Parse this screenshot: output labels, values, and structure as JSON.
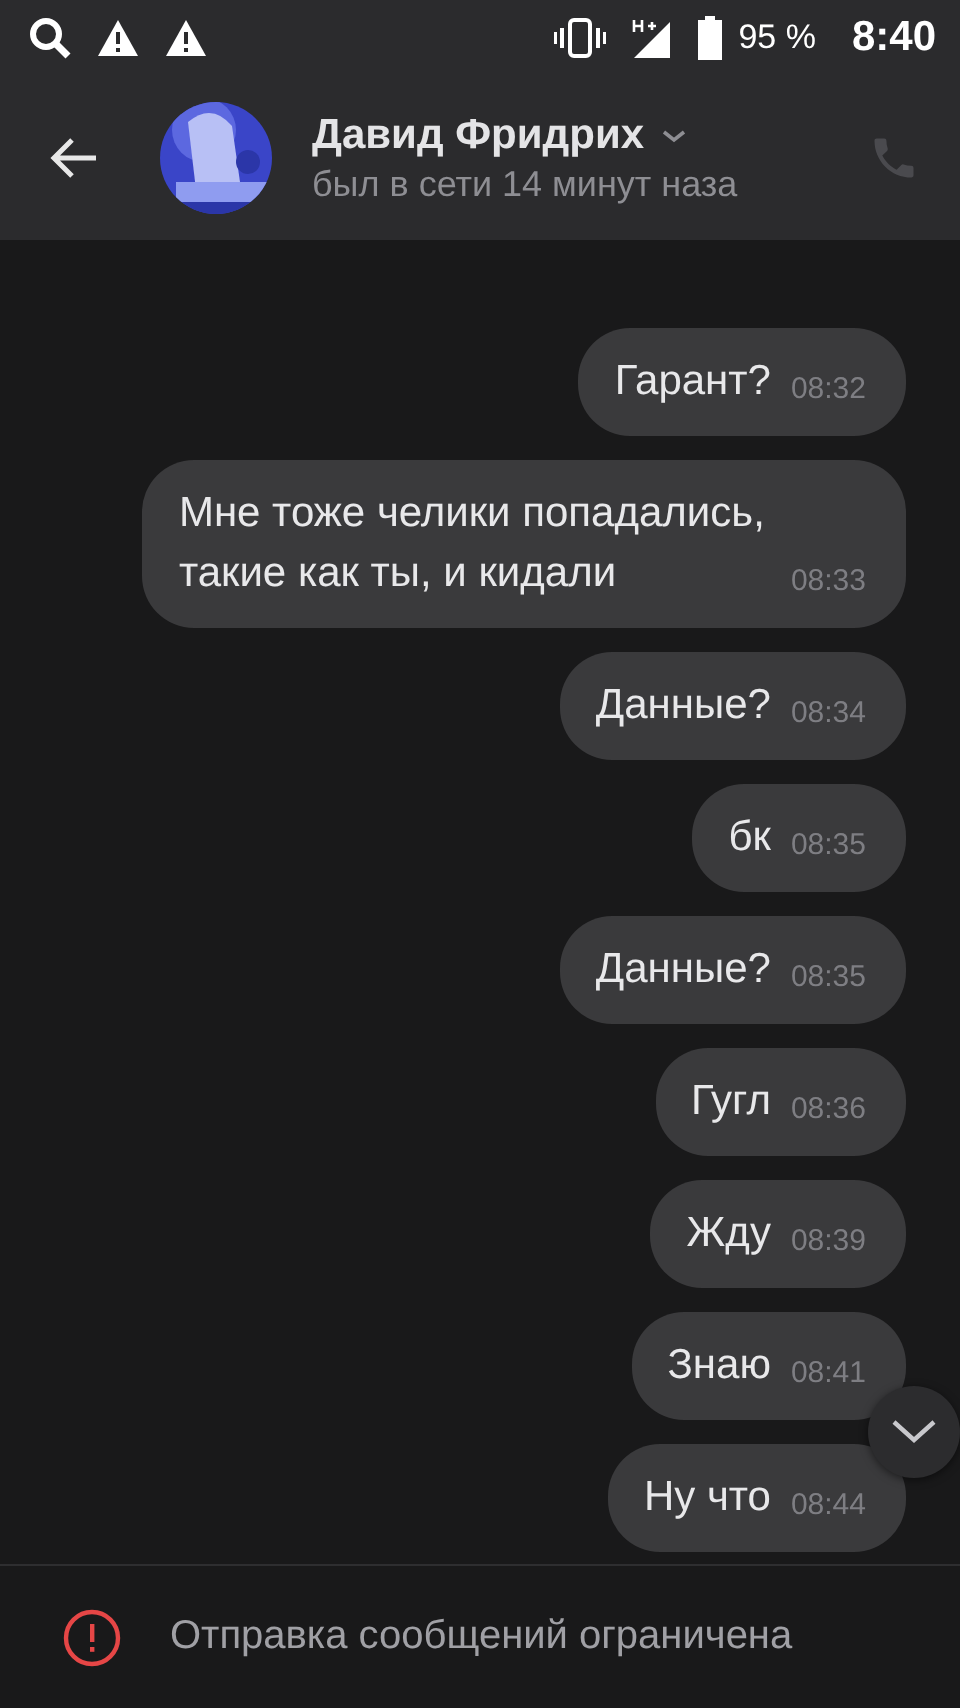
{
  "status_bar": {
    "battery": "95 %",
    "time": "8:40"
  },
  "header": {
    "name": "Давид Фридрих",
    "status": "был в сети 14 минут наза"
  },
  "messages": [
    {
      "text": "Гарант?",
      "time": "08:32"
    },
    {
      "text": "Мне тоже челики попадались, такие как ты, и кидали",
      "time": "08:33"
    },
    {
      "text": "Данные?",
      "time": "08:34"
    },
    {
      "text": "бк",
      "time": "08:35"
    },
    {
      "text": "Данные?",
      "time": "08:35"
    },
    {
      "text": "Гугл",
      "time": "08:36"
    },
    {
      "text": "Жду",
      "time": "08:39"
    },
    {
      "text": "Знаю",
      "time": "08:41"
    },
    {
      "text": "Ну что",
      "time": "08:44"
    }
  ],
  "footer": {
    "notice": "Отправка сообщений ограничена"
  }
}
